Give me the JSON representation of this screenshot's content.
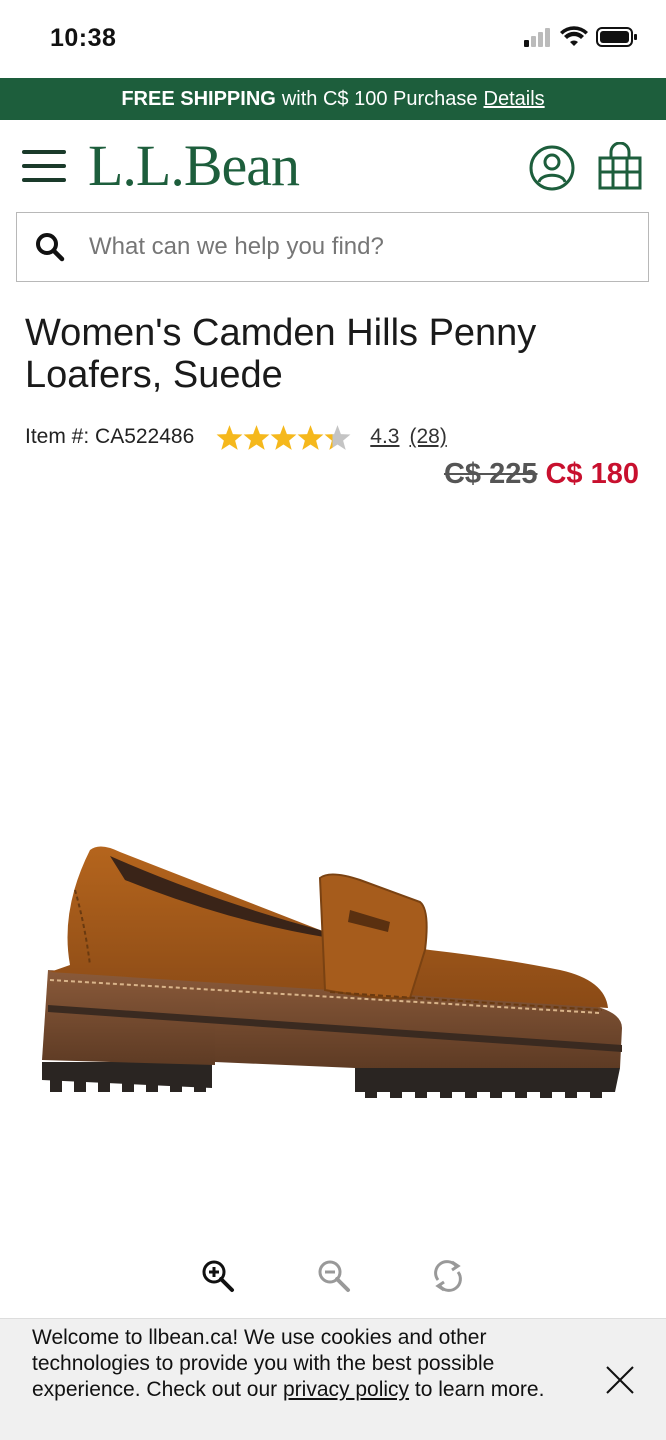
{
  "status_bar": {
    "time": "10:38"
  },
  "promo": {
    "bold": "FREE SHIPPING",
    "text": "with C$ 100 Purchase",
    "link": "Details"
  },
  "header": {
    "logo": "L.L.Bean"
  },
  "search": {
    "placeholder": "What can we help you find?"
  },
  "product": {
    "title": "Women's Camden Hills Penny Loafers, Suede",
    "item_number": "Item #: CA522486",
    "rating": {
      "value": "4.3",
      "count": "(28)",
      "stars_filled": 4.3,
      "stars_total": 5
    },
    "price_old": "C$ 225",
    "price_new": "C$ 180"
  },
  "colors": {
    "brand_green": "#1d5e3c",
    "sale_red": "#c8102e",
    "star_gold": "#f5b81c"
  },
  "zoom_controls": {
    "icons": [
      "zoom-in-icon",
      "zoom-out-icon",
      "rotate-icon"
    ]
  },
  "cookie_banner": {
    "text_before": "Welcome to llbean.ca! We use cookies and other technologies to provide you with the best possible experience. Check out our",
    "link": "privacy policy",
    "text_after": "to learn more."
  }
}
